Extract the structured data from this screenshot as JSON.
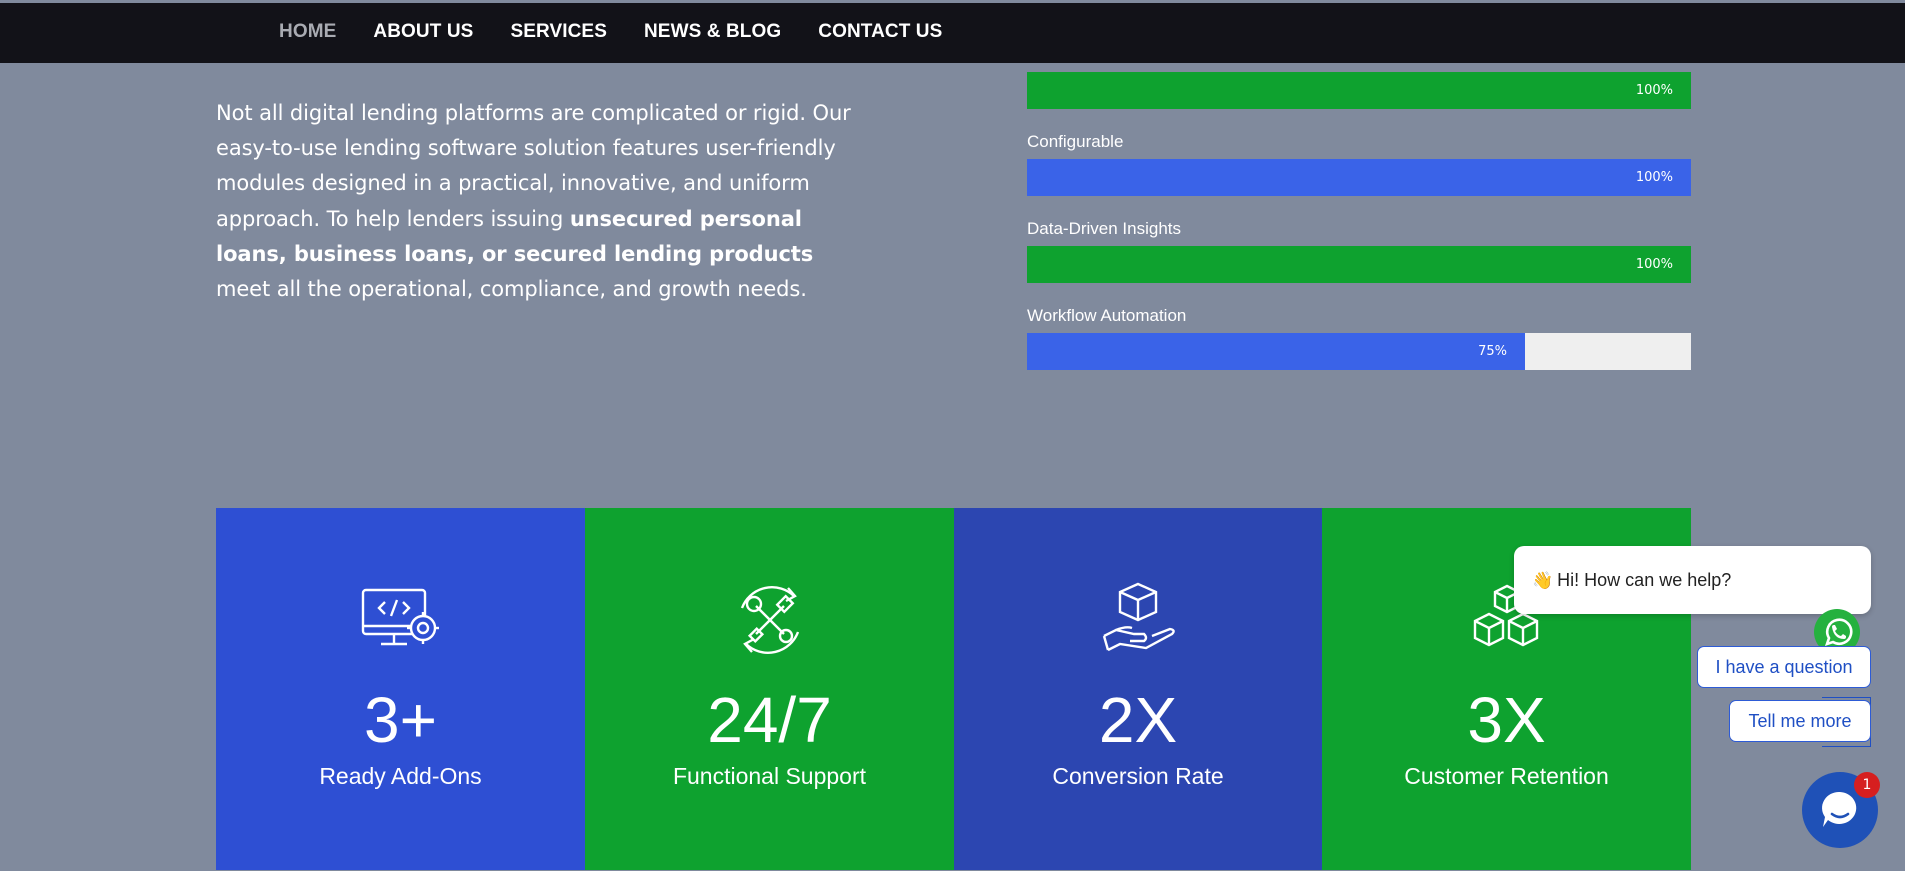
{
  "nav": {
    "items": [
      {
        "label": "HOME",
        "active": true
      },
      {
        "label": "ABOUT US",
        "active": false
      },
      {
        "label": "SERVICES",
        "active": false
      },
      {
        "label": "NEWS & BLOG",
        "active": false
      },
      {
        "label": "CONTACT US",
        "active": false
      }
    ]
  },
  "intro": {
    "text_1": "Not all digital lending platforms are complicated or rigid. Our easy-to-use lending software solution features user-friendly modules designed in a practical, innovative, and uniform approach. To help lenders issuing ",
    "bold": "unsecured personal loans, business loans, or secured lending products",
    "text_2": " meet all the operational, compliance, and growth needs."
  },
  "skills": [
    {
      "label": "",
      "percent": 100,
      "percent_label": "100%",
      "color": "#0ea22f"
    },
    {
      "label": "Configurable",
      "percent": 100,
      "percent_label": "100%",
      "color": "#3a63e8"
    },
    {
      "label": "Data-Driven Insights",
      "percent": 100,
      "percent_label": "100%",
      "color": "#0ea22f"
    },
    {
      "label": "Workflow Automation",
      "percent": 75,
      "percent_label": "75%",
      "color": "#3a63e8"
    }
  ],
  "stats": [
    {
      "icon": "code-monitor-gear-icon",
      "value": "3+",
      "label": "Ready Add-Ons",
      "color": "#2e4fd3"
    },
    {
      "icon": "tools-cycle-icon",
      "value": "24/7",
      "label": "Functional Support",
      "color": "#0ea22f"
    },
    {
      "icon": "hand-box-icon",
      "value": "2X",
      "label": "Conversion Rate",
      "color": "#2c46b1"
    },
    {
      "icon": "stacked-boxes-icon",
      "value": "3X",
      "label": "Customer Retention",
      "color": "#0ea22f"
    }
  ],
  "chat": {
    "greeting_emoji": "👋",
    "greeting": "Hi! How can we help?",
    "buttons": [
      "I have a question",
      "Tell me more"
    ],
    "notification_count": "1"
  },
  "colors": {
    "page_bg": "#808a9d",
    "nav_bg": "#121218",
    "green": "#0ea22f",
    "blue": "#3a63e8"
  }
}
